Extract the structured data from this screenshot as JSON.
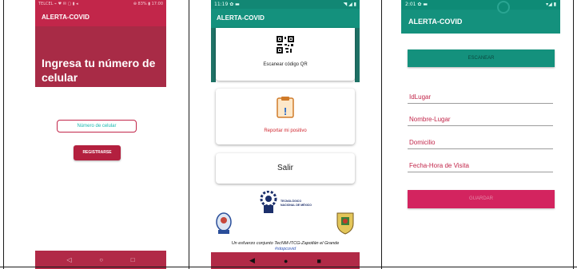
{
  "screen1": {
    "status_left": "TELCEL ⌁ ♥ ✉ ▢ ▮ ◂",
    "status_right": "⊕ 83% ▮ 17:00",
    "app_title": "ALERTA-COVID",
    "hero_text": "Ingresa tu número de celular",
    "phone_placeholder": "Número de celular",
    "register_label": "REGISTRARSE",
    "nav_icons": [
      "◁",
      "○",
      "□"
    ]
  },
  "screen2": {
    "status_time": "11:19",
    "status_icons_left": "✿ ▬",
    "status_icons_right": "◥ ◢ ▮",
    "app_title": "ALERTA-COVID",
    "scan_qr_label": "Escanear código QR",
    "report_label": "Reportar mi positivo",
    "report_glyph": "!",
    "exit_label": "Salir",
    "tec_name_line1": "TECNOLÓGICO",
    "tec_name_line2": "NACIONAL DE MÉXICO",
    "footer_text": "Un esfuerzo conjunto TecNM-ITCG-Zapotlán el Grande",
    "hashtag": "#stopcovid",
    "nav_icons": [
      "◀",
      "●",
      "■"
    ]
  },
  "screen3": {
    "status_time": "2:01",
    "status_icons_left": "✿ ▬",
    "status_icons_right": "▾◢ ▮",
    "app_title": "ALERTA-COVID",
    "scan_label": "ESCANEAR",
    "fields": [
      "IdLugar",
      "Nombre-Lugar",
      "Domicilio",
      "Fecha-Hora de Visita"
    ],
    "save_label": "GUARDAR"
  },
  "colors": {
    "crimson": "#c2264a",
    "teal": "#14917d",
    "pink_button": "#d3245f"
  }
}
